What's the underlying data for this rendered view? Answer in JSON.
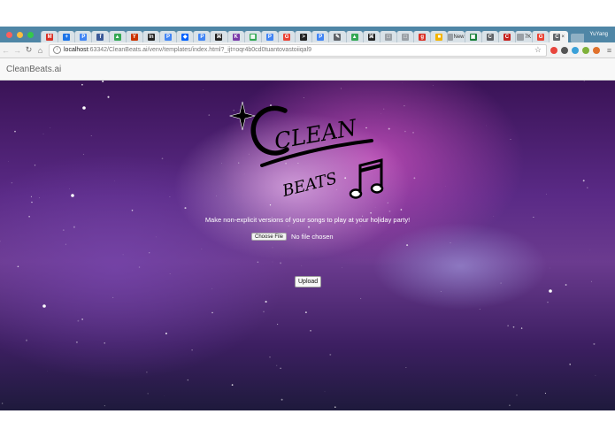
{
  "browser": {
    "tabs": [
      {
        "fav": "M",
        "color": "#d93025",
        "label": ""
      },
      {
        "fav": "+",
        "color": "#1a73e8",
        "label": ""
      },
      {
        "fav": "P",
        "color": "#4285f4",
        "label": ""
      },
      {
        "fav": "f",
        "color": "#3b5998",
        "label": ""
      },
      {
        "fav": "▲",
        "color": "#34a853",
        "label": ""
      },
      {
        "fav": "Y",
        "color": "#cc3300",
        "label": ""
      },
      {
        "fav": "In",
        "color": "#222222",
        "label": ""
      },
      {
        "fav": "P",
        "color": "#4285f4",
        "label": ""
      },
      {
        "fav": "◆",
        "color": "#0061fe",
        "label": ""
      },
      {
        "fav": "P",
        "color": "#4285f4",
        "label": ""
      },
      {
        "fav": "⌘",
        "color": "#222222",
        "label": ""
      },
      {
        "fav": "K",
        "color": "#7a3aa8",
        "label": ""
      },
      {
        "fav": "▦",
        "color": "#34a853",
        "label": ""
      },
      {
        "fav": "P",
        "color": "#4285f4",
        "label": ""
      },
      {
        "fav": "G",
        "color": "#ea4335",
        "label": ""
      },
      {
        "fav": ">",
        "color": "#222222",
        "label": ""
      },
      {
        "fav": "P",
        "color": "#4285f4",
        "label": ""
      },
      {
        "fav": "✎",
        "color": "#5f6368",
        "label": ""
      },
      {
        "fav": "▲",
        "color": "#34a853",
        "label": ""
      },
      {
        "fav": "⌘",
        "color": "#222222",
        "label": ""
      },
      {
        "fav": "□",
        "color": "#9aa0a6",
        "label": ""
      },
      {
        "fav": "□",
        "color": "#9aa0a6",
        "label": ""
      },
      {
        "fav": "g",
        "color": "#d93025",
        "label": ""
      },
      {
        "fav": "■",
        "color": "#f4b400",
        "label": ""
      },
      {
        "fav": "",
        "color": "#9aa0a6",
        "label": "New"
      },
      {
        "fav": "▣",
        "color": "#188038",
        "label": ""
      },
      {
        "fav": "C",
        "color": "#5f6368",
        "label": ""
      },
      {
        "fav": "C",
        "color": "#c5221f",
        "label": ""
      },
      {
        "fav": "",
        "color": "#9aa0a6",
        "label": "7K"
      },
      {
        "fav": "G",
        "color": "#ea4335",
        "label": ""
      },
      {
        "fav": "C",
        "color": "#5f6368",
        "label": "×"
      }
    ],
    "profile": "YuYang",
    "url_host": "localhost",
    "url_rest": ":63342/CleanBeats.ai/venv/templates/index.html?_ijt=oqr4b0cd0tuantovastoiiqal9"
  },
  "page": {
    "brand": "CleanBeats.ai",
    "logo": {
      "line1": "CLEAN",
      "line2": "BEATS"
    },
    "tagline": "Make non-explicit versions of your songs to play at your holiday party!",
    "choose_file_label": "Choose File",
    "file_status": "No file chosen",
    "upload_label": "Upload"
  },
  "colors": {
    "tabstrip": "#4f86a6",
    "toolbar": "#f2f2f2",
    "navbar": "#f8f8f8",
    "galaxy_pink": "#cd50be",
    "galaxy_purple": "#5a2a86"
  }
}
